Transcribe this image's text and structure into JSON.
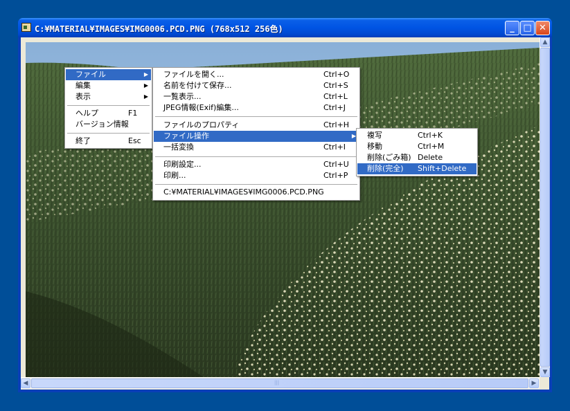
{
  "window": {
    "title": "C:¥MATERIAL¥IMAGES¥IMG0006.PCD.PNG (768x512 256色)"
  },
  "controls": {
    "minimize": "_",
    "maximize": "□",
    "close": "✕"
  },
  "photo": {
    "subject": "hillside of white daffodils under blue sky",
    "colors": {
      "sky": "#9dbfe0",
      "grass": "#3d5230",
      "flowers": "#e6e2bd"
    }
  },
  "menus": {
    "main": [
      {
        "label": "ファイル",
        "shortcut": "",
        "submenu": true,
        "selected": true
      },
      {
        "label": "編集",
        "shortcut": "",
        "submenu": true
      },
      {
        "label": "表示",
        "shortcut": "",
        "submenu": true
      },
      {
        "label": "ヘルプ",
        "shortcut": "F1"
      },
      {
        "label": "バージョン情報",
        "shortcut": ""
      },
      {
        "label": "終了",
        "shortcut": "Esc"
      }
    ],
    "file": [
      {
        "label": "ファイルを開く...",
        "shortcut": "Ctrl+O"
      },
      {
        "label": "名前を付けて保存...",
        "shortcut": "Ctrl+S"
      },
      {
        "label": "一覧表示...",
        "shortcut": "Ctrl+L"
      },
      {
        "label": "JPEG情報(Exif)編集...",
        "shortcut": "Ctrl+J"
      },
      {
        "label": "ファイルのプロパティ",
        "shortcut": "Ctrl+H"
      },
      {
        "label": "ファイル操作",
        "shortcut": "",
        "submenu": true,
        "selected": true
      },
      {
        "label": "一括変換",
        "shortcut": "Ctrl+I"
      },
      {
        "label": "印刷設定...",
        "shortcut": "Ctrl+U"
      },
      {
        "label": "印刷...",
        "shortcut": "Ctrl+P"
      },
      {
        "label": "C:¥MATERIAL¥IMAGES¥IMG0006.PCD.PNG",
        "shortcut": ""
      }
    ],
    "fileops": [
      {
        "label": "複写",
        "shortcut": "Ctrl+K"
      },
      {
        "label": "移動",
        "shortcut": "Ctrl+M"
      },
      {
        "label": "削除(ごみ箱)",
        "shortcut": "Delete"
      },
      {
        "label": "削除(完全)",
        "shortcut": "Shift+Delete",
        "selected": true
      }
    ]
  },
  "arrow": "▶",
  "scroll": {
    "up": "▲",
    "down": "▼",
    "left": "◀",
    "right": "▶",
    "grip": "|||"
  }
}
